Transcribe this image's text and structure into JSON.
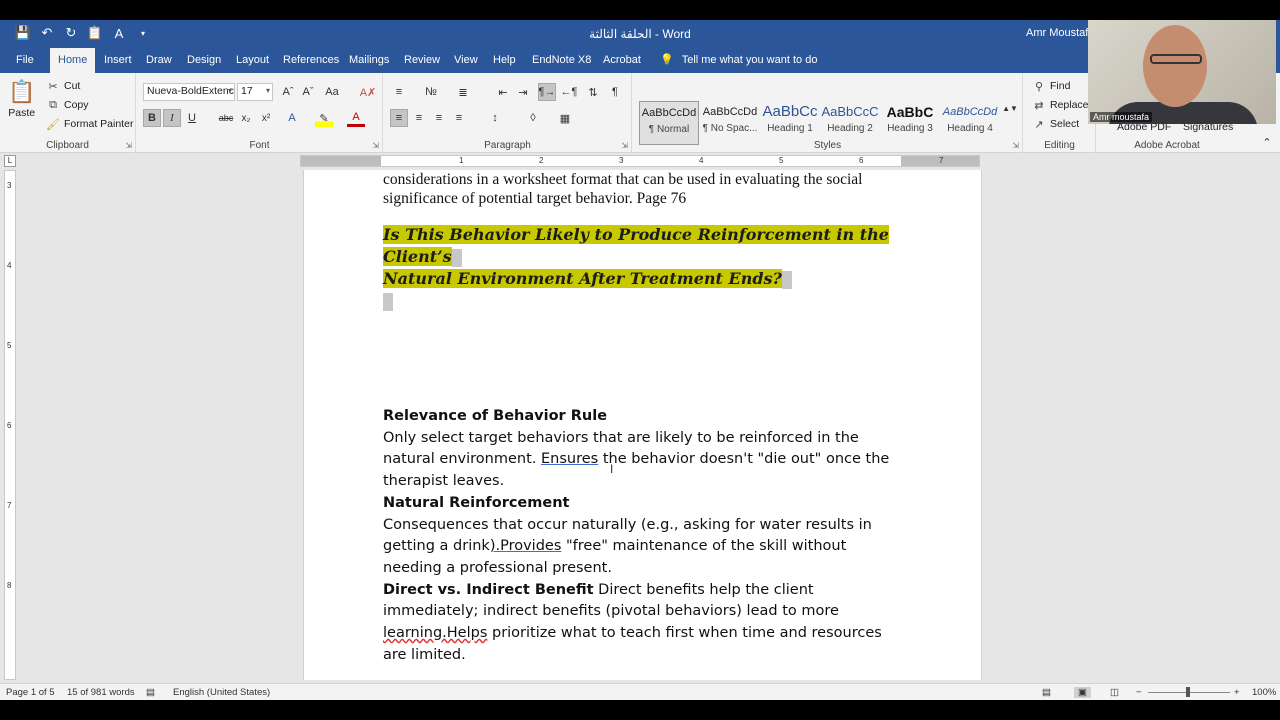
{
  "window": {
    "title": "الحلقة الثالثة  -  Word",
    "user": "Amr Moustafa"
  },
  "tabs": [
    "File",
    "Home",
    "Insert",
    "Draw",
    "Design",
    "Layout",
    "References",
    "Mailings",
    "Review",
    "View",
    "Help",
    "EndNote X8",
    "Acrobat"
  ],
  "tell_me": "Tell me what you want to do",
  "clipboard": {
    "paste": "Paste",
    "cut": "Cut",
    "copy": "Copy",
    "format_painter": "Format Painter",
    "label": "Clipboard"
  },
  "font": {
    "name": "Nueva-BoldExtenc",
    "size": "17",
    "label": "Font"
  },
  "paragraph": {
    "label": "Paragraph"
  },
  "styles": {
    "label": "Styles",
    "items": [
      {
        "preview": "AaBbCcDd",
        "name": "¶ Normal"
      },
      {
        "preview": "AaBbCcDd",
        "name": "¶ No Spac..."
      },
      {
        "preview": "AaBbCc",
        "name": "Heading 1"
      },
      {
        "preview": "AaBbCcC",
        "name": "Heading 2"
      },
      {
        "preview": "AaBbC",
        "name": "Heading 3"
      },
      {
        "preview": "AaBbCcDd",
        "name": "Heading 4"
      }
    ]
  },
  "editing": {
    "find": "Find",
    "replace": "Replace",
    "select": "Select",
    "label": "Editing"
  },
  "acrobat": {
    "pdf": "Adobe PDF",
    "signatures": "Signatures",
    "label": "Adobe Acrobat"
  },
  "webcam": {
    "name": "Amr moustafa"
  },
  "document": {
    "intro_line1": "considerations in a worksheet format that can be used in evaluating the social",
    "intro_line2": "significance of potential target behavior. Page 76",
    "heading_line1": "Is This Behavior Likely to Produce Reinforcement in the",
    "heading_line2": "Client’s",
    "heading_line3": "Natural Environment After Treatment Ends?",
    "s1_title": "Relevance of Behavior Rule",
    "s1_text_a": "Only select target behaviors that are likely to be reinforced in the natural environment. ",
    "s1_ensures": "Ensures",
    "s1_text_b": " the behavior doesn't \"die out\" once the therapist leaves.",
    "s2_title": "Natural Reinforcement",
    "s2_text_a": "Consequences that occur naturally (e.g., asking for water results in getting a drink",
    "s2_provides": ").Provides",
    "s2_text_b": " \"free\" maintenance of the skill without needing a professional present.",
    "s3_title": "Direct vs. Indirect Benefit",
    "s3_text_a": " Direct benefits help the client immediately; indirect benefits (pivotal behaviors) lead to more ",
    "s3_learning": "learning.Helps",
    "s3_text_b": " prioritize what to teach first when time and resources are limited."
  },
  "status": {
    "page": "Page 1 of 5",
    "words": "15 of 981 words",
    "language": "English (United States)",
    "zoom": "100%"
  }
}
